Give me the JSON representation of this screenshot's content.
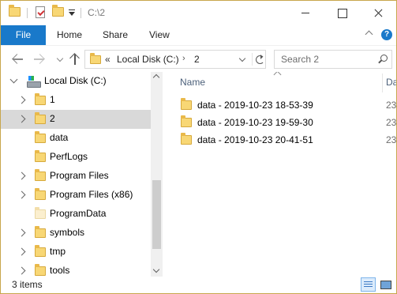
{
  "window": {
    "title": "C:\\2"
  },
  "ribbon": {
    "file": "File",
    "tabs": [
      "Home",
      "Share",
      "View"
    ],
    "help": "?"
  },
  "address": {
    "overflow": "«",
    "segments": [
      "Local Disk (C:)",
      "2"
    ]
  },
  "search": {
    "placeholder": "Search 2"
  },
  "nav": {
    "root": "Local Disk (C:)",
    "items": [
      {
        "label": "1",
        "expandable": true
      },
      {
        "label": "2",
        "expandable": true,
        "selected": true
      },
      {
        "label": "data",
        "expandable": false
      },
      {
        "label": "PerfLogs",
        "expandable": false
      },
      {
        "label": "Program Files",
        "expandable": true
      },
      {
        "label": "Program Files (x86)",
        "expandable": true
      },
      {
        "label": "ProgramData",
        "expandable": false,
        "hidden": true
      },
      {
        "label": "symbols",
        "expandable": true
      },
      {
        "label": "tmp",
        "expandable": true
      },
      {
        "label": "tools",
        "expandable": true
      }
    ]
  },
  "columns": {
    "name": "Name",
    "date": "Da"
  },
  "files": [
    {
      "name": "data - 2019-10-23 18-53-39",
      "date": "23/"
    },
    {
      "name": "data - 2019-10-23 19-59-30",
      "date": "23/"
    },
    {
      "name": "data - 2019-10-23 20-41-51",
      "date": "23/"
    }
  ],
  "status": {
    "item_count": "3 items"
  },
  "colors": {
    "accent": "#1979ca",
    "selection": "#d9d9d9",
    "folder": "#f8d775",
    "header_text": "#4c607a"
  }
}
